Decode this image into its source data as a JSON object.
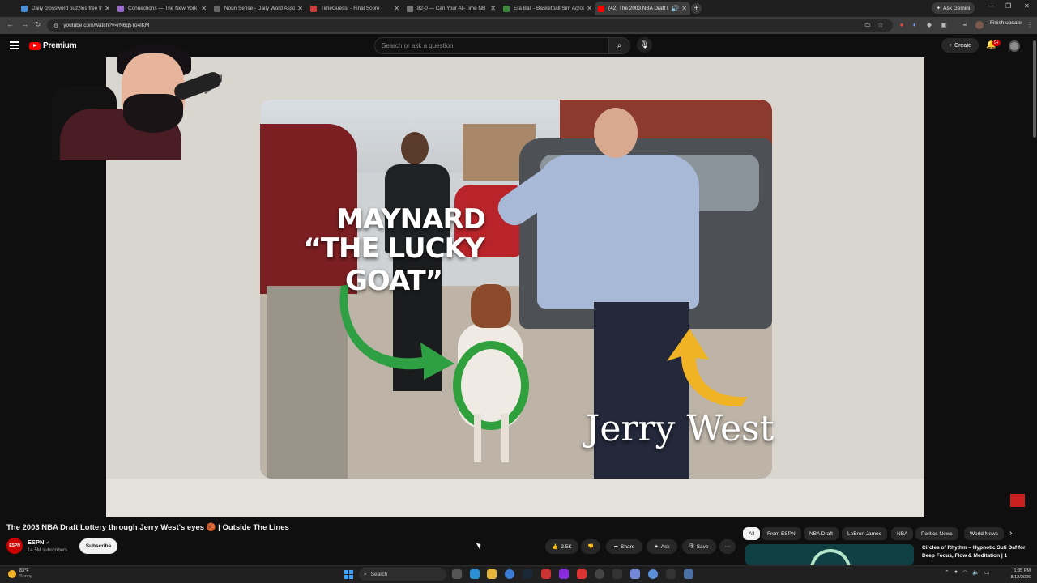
{
  "browser": {
    "tabs": [
      {
        "title": "Daily crossword puzzles free fr",
        "favicon_color": "#4a90d9"
      },
      {
        "title": "Connections — The New York",
        "favicon_color": "#9b6bd1"
      },
      {
        "title": "Noun Sense - Daily Word Asso",
        "favicon_color": "#666666"
      },
      {
        "title": "TimeGuessr - Final Score",
        "favicon_color": "#d43b3b"
      },
      {
        "title": "82-0 — Can Your All-Time NB",
        "favicon_color": "#777777"
      },
      {
        "title": "Era Ball - Basketball Sim Acros",
        "favicon_color": "#3c8a3c"
      },
      {
        "title": "(42) The 2003 NBA Draft Lo",
        "favicon_color": "#ff0000"
      }
    ],
    "ask_gemini": "Ask Gemini",
    "url": "youtube.com/watch?v=rN6q5To4lKM",
    "finish_update": "Finish update"
  },
  "youtube": {
    "logo_text": "Premium",
    "search_placeholder": "Search or ask a question",
    "create_label": "Create",
    "notification_count": "9+",
    "captions": {
      "goat_name": "MAYNARD",
      "goat_nickname": "“THE LUCKY GOAT”",
      "person": "Jerry West"
    },
    "video_title": "The 2003 NBA Draft Lottery through Jerry West's eyes 🏀 | Outside The Lines",
    "channel": {
      "name": "ESPN",
      "logo_text": "ESPN",
      "subscribers": "14.5M subscribers",
      "subscribe_label": "Subscribe"
    },
    "actions": {
      "likes": "2.5K",
      "share": "Share",
      "ask": "Ask",
      "save": "Save"
    },
    "chips": [
      "All",
      "From ESPN",
      "NBA Draft",
      "LeBron James",
      "NBA",
      "Politics News",
      "World News"
    ],
    "recommendation": {
      "title": "Circles of Rhythm – Hypnotic Sufi Daf for Deep Focus, Flow & Meditation | 1"
    }
  },
  "taskbar": {
    "temperature": "83°F",
    "condition": "Sunny",
    "search_placeholder": "Search",
    "time": "1:35 PM",
    "date": "8/12/2026"
  }
}
